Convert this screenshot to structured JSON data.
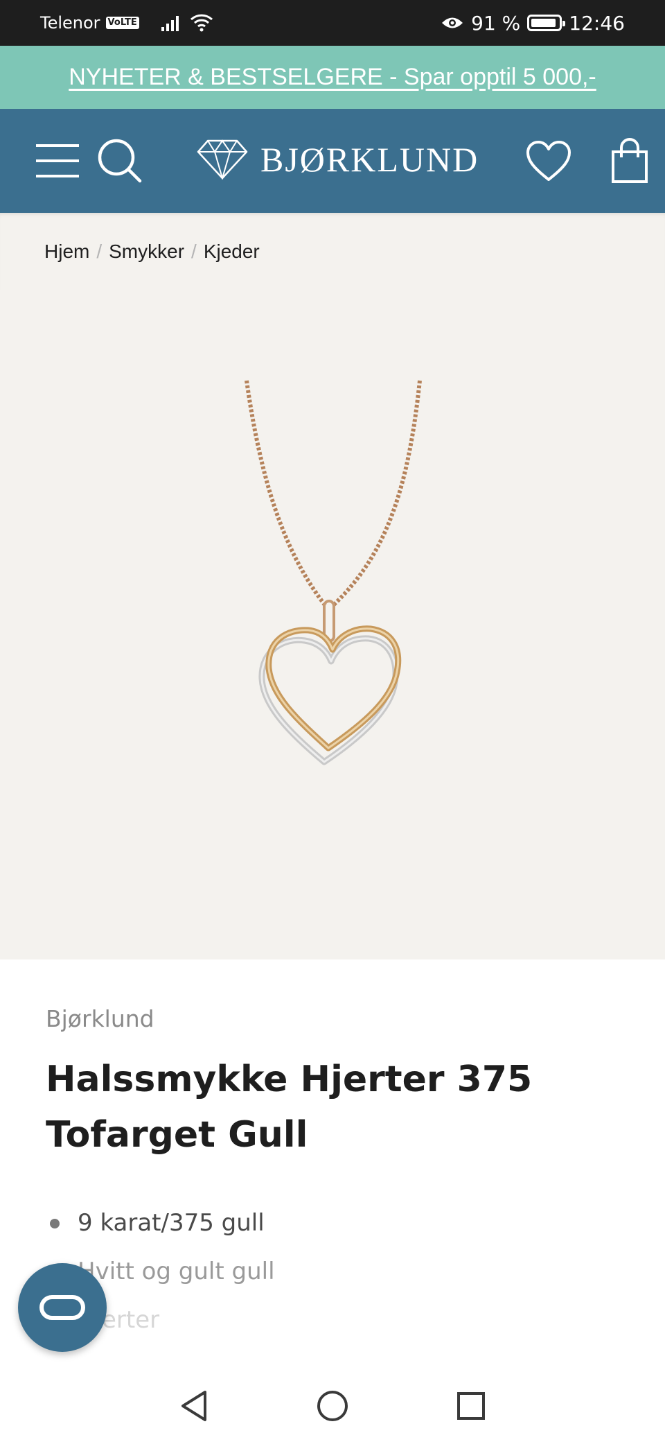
{
  "status_bar": {
    "carrier": "Telenor",
    "volte": "VoLTE",
    "battery_percent": "91 %",
    "battery_level": 0.91,
    "time": "12:46"
  },
  "promo": {
    "text": "NYHETER & BESTSELGERE - Spar opptil 5 000,-"
  },
  "header": {
    "logo_text": "BJØRKLUND"
  },
  "breadcrumb": {
    "items": [
      "Hjem",
      "Smykker",
      "Kjeder"
    ],
    "separator": "/"
  },
  "product": {
    "brand": "Bjørklund",
    "title_line1": "Halssmykke Hjerter 375",
    "title_line2": "Tofarget Gull",
    "features": [
      "9 karat/375 gull",
      "Hvitt og gult gull",
      "Hjerter"
    ]
  },
  "colors": {
    "promo_bg": "#7ec6b6",
    "header_bg": "#3b6f8f",
    "image_bg": "#f4f2ee"
  },
  "icons": {
    "menu": "menu-icon",
    "search": "search-icon",
    "logo": "diamond-icon",
    "wishlist": "heart-icon",
    "cart": "shopping-bag-icon",
    "chat": "chat-icon",
    "nav_back": "back-icon",
    "nav_home": "home-icon",
    "nav_recents": "recents-icon"
  }
}
